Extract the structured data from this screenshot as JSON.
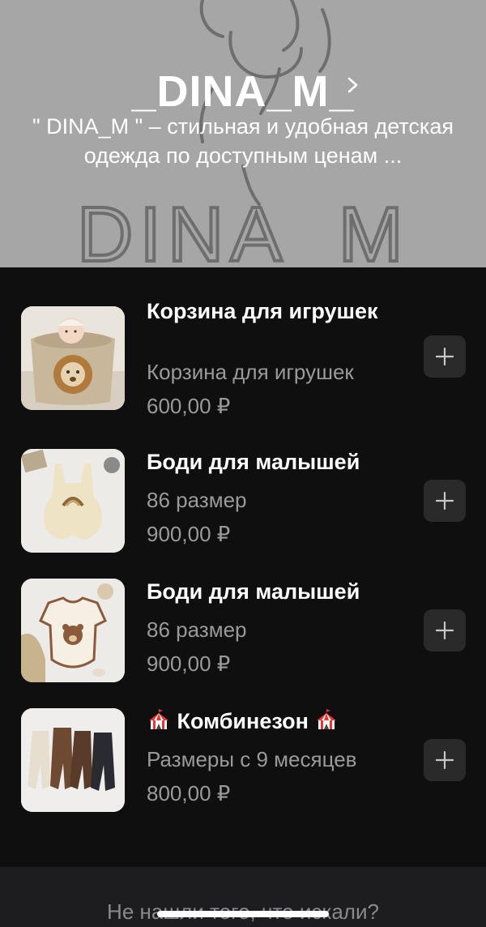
{
  "store": {
    "title": "_DINA_M_",
    "description": "\" DINA_M \" – стильная и удобная детская одежда по доступным ценам ...",
    "background_logo_text": "DINA_M",
    "header_bg": "#a6a6a6"
  },
  "products": [
    {
      "title": "Корзина для игрушек",
      "subtitle": "Корзина для игрушек",
      "price": "600,00 ₽",
      "image": "toy-basket-lion"
    },
    {
      "title": "Боди для малышей",
      "subtitle": "86 размер",
      "price": "900,00 ₽",
      "image": "rainbow-bodysuit"
    },
    {
      "title": "Боди для малышей",
      "subtitle": "86 размер",
      "price": "900,00 ₽",
      "image": "bear-bodysuit"
    },
    {
      "title": "Комбинезон",
      "title_icon": "circus-tent-icon",
      "subtitle": "Размеры с 9 месяцев",
      "price": "800,00 ₽",
      "image": "overalls-set"
    }
  ],
  "add_button_icon": "plus-icon",
  "footer": {
    "text": "Не нашли того, что искали?"
  }
}
